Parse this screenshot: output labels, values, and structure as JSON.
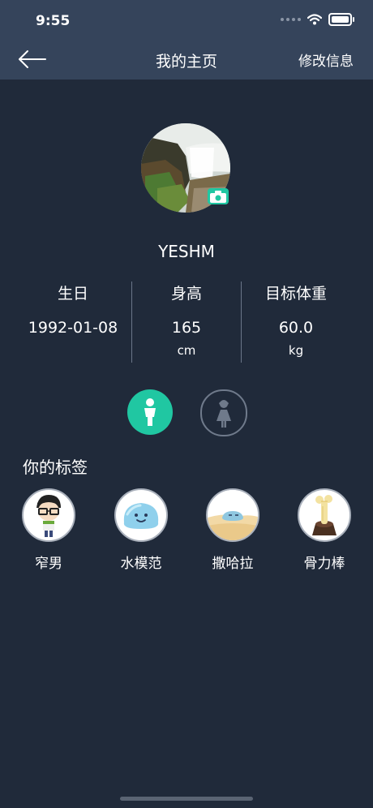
{
  "status_bar": {
    "time": "9:55"
  },
  "nav": {
    "title": "我的主页",
    "edit_label": "修改信息"
  },
  "profile": {
    "username": "YESHM"
  },
  "stats": [
    {
      "label": "生日",
      "value": "1992-01-08",
      "unit": ""
    },
    {
      "label": "身高",
      "value": "165",
      "unit": "cm"
    },
    {
      "label": "目标体重",
      "value": "60.0",
      "unit": "kg"
    }
  ],
  "gender": {
    "selected": "male"
  },
  "tags": {
    "heading": "你的标签",
    "items": [
      {
        "label": "窄男",
        "icon": "nerd-boy-icon"
      },
      {
        "label": "水模范",
        "icon": "blue-blob-icon"
      },
      {
        "label": "撒哈拉",
        "icon": "desert-icon"
      },
      {
        "label": "骨力棒",
        "icon": "bone-trophy-icon"
      }
    ]
  },
  "colors": {
    "background": "#202a3a",
    "header": "#35445b",
    "accent": "#20c7a2"
  }
}
